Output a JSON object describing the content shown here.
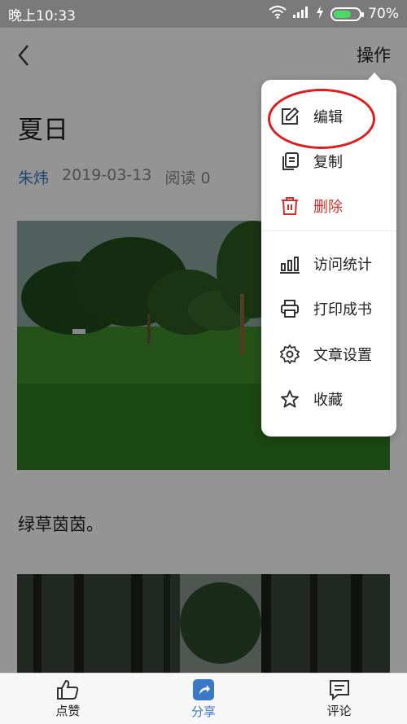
{
  "status_bar": {
    "time": "晚上10:33",
    "battery": "70%"
  },
  "nav": {
    "operations_label": "操作"
  },
  "article": {
    "title": "夏日",
    "author": "朱炜",
    "date": "2019-03-13",
    "reads": "阅读 0",
    "caption": "绿草茵茵。"
  },
  "menu": {
    "items": [
      {
        "label": "编辑",
        "icon": "edit-icon"
      },
      {
        "label": "复制",
        "icon": "copy-icon"
      },
      {
        "label": "删除",
        "icon": "trash-icon"
      },
      {
        "label": "访问统计",
        "icon": "bar-chart-icon"
      },
      {
        "label": "打印成书",
        "icon": "printer-icon"
      },
      {
        "label": "文章设置",
        "icon": "gear-icon"
      },
      {
        "label": "收藏",
        "icon": "star-icon"
      }
    ]
  },
  "bottom_bar": {
    "like": "点赞",
    "share": "分享",
    "comment": "评论"
  },
  "colors": {
    "accent": "#3b78c7",
    "danger": "#d0302a",
    "highlight": "#e11b1b"
  }
}
